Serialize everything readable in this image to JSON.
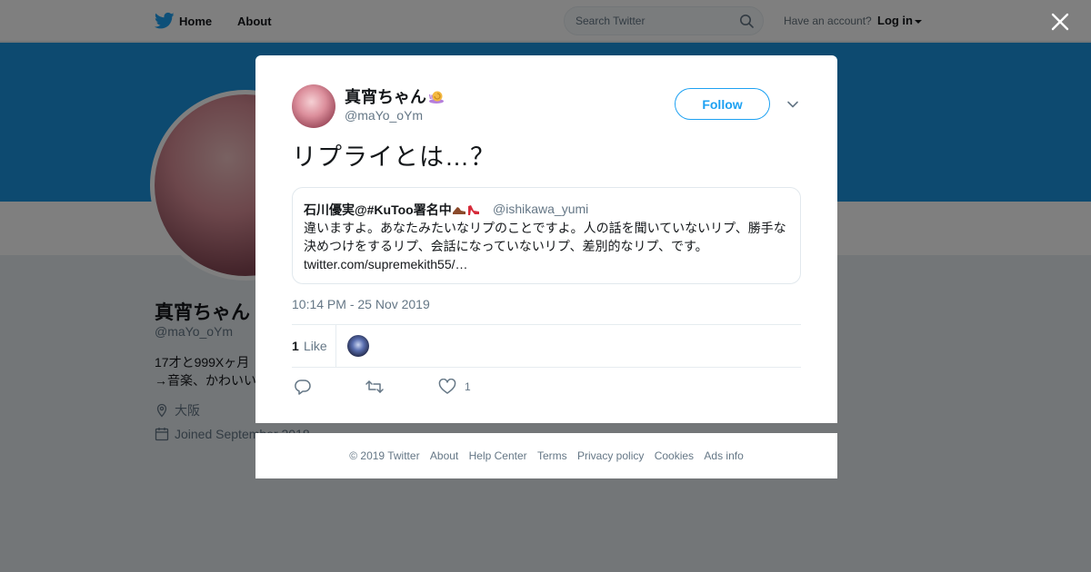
{
  "nav": {
    "home": "Home",
    "about": "About",
    "search_placeholder": "Search Twitter",
    "have_account": "Have an account?",
    "login": "Log in"
  },
  "profile": {
    "name": "真宵ちゃん",
    "handle": "@maYo_oYm",
    "bio_line1": "17才と999Xヶ月",
    "bio_line2": "→音楽、かわいい",
    "location": "大阪",
    "joined": "Joined September 2018"
  },
  "tweet": {
    "author_name": "真宵ちゃん",
    "author_handle": "@maYo_oYm",
    "follow_label": "Follow",
    "text": "リプライとは…？",
    "timestamp": "10:14 PM - 25 Nov 2019",
    "likes_count": "1",
    "likes_label": "Like",
    "like_action_count": "1"
  },
  "quoted": {
    "name": "石川優実@#KuToo署名中",
    "handle": "@ishikawa_yumi",
    "text_line1": "違いますよ。あなたみたいなリプのことですよ。人の話を聞いていないリプ、勝手な",
    "text_line2": "決めつけをするリプ、会話になっていないリプ、差別的なリプ、です。",
    "link": "twitter.com/supremekith55/…"
  },
  "footer": {
    "copyright": "© 2019 Twitter",
    "about": "About",
    "help": "Help Center",
    "terms": "Terms",
    "privacy": "Privacy policy",
    "cookies": "Cookies",
    "ads": "Ads info"
  },
  "colors": {
    "accent": "#1da1f2",
    "banner": "#1b95e0",
    "muted": "#657786"
  },
  "icons": [
    "twitter-bird-icon",
    "search-icon",
    "close-icon",
    "snail-icon",
    "shoe-icon",
    "heel-icon",
    "chevron-down-icon",
    "reply-icon",
    "retweet-icon",
    "heart-icon",
    "location-icon",
    "calendar-icon"
  ]
}
